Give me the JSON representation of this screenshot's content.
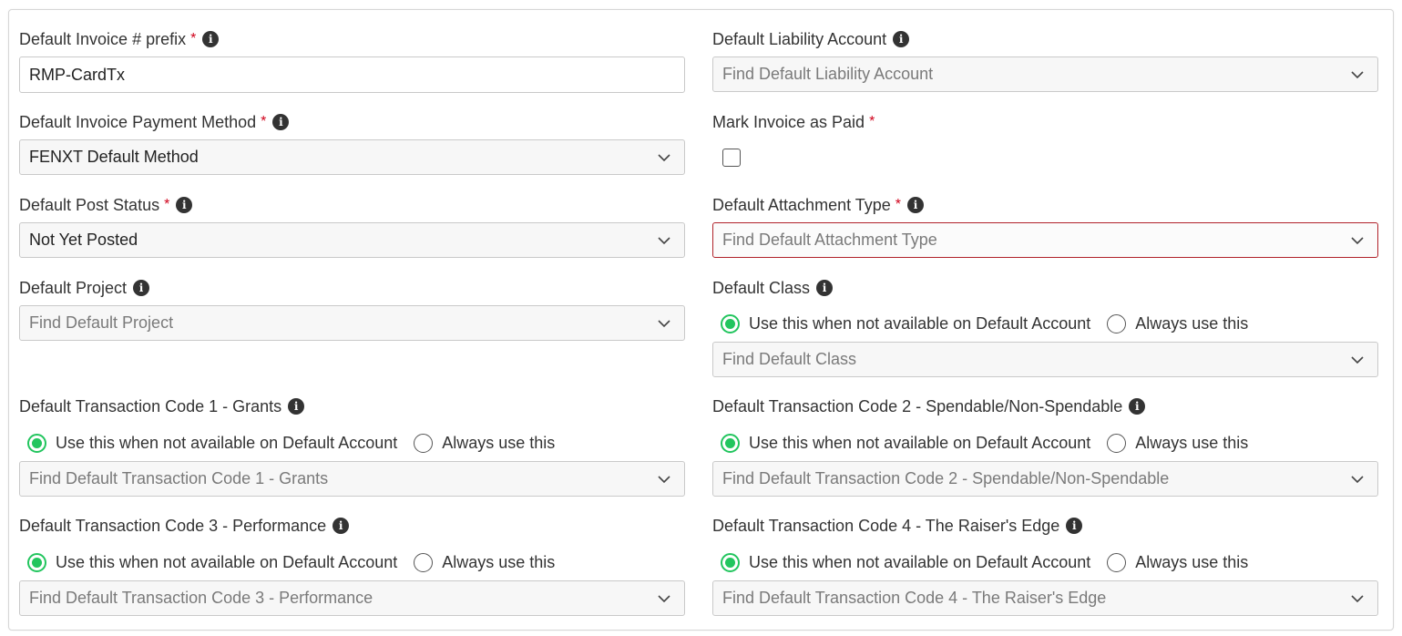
{
  "fields": {
    "invoice_prefix": {
      "label": "Default Invoice # prefix",
      "value": "RMP-CardTx"
    },
    "liability_account": {
      "label": "Default Liability Account",
      "placeholder": "Find Default Liability Account"
    },
    "payment_method": {
      "label": "Default Invoice Payment Method",
      "value": "FENXT Default Method"
    },
    "mark_paid": {
      "label": "Mark Invoice as Paid",
      "checked": false
    },
    "post_status": {
      "label": "Default Post Status",
      "value": "Not Yet Posted"
    },
    "attachment_type": {
      "label": "Default Attachment Type",
      "placeholder": "Find Default Attachment Type"
    },
    "project": {
      "label": "Default Project",
      "placeholder": "Find Default Project"
    },
    "class": {
      "label": "Default Class",
      "placeholder": "Find Default Class"
    },
    "tx_code_1": {
      "label": "Default Transaction Code 1 - Grants",
      "placeholder": "Find Default Transaction Code 1 - Grants"
    },
    "tx_code_2": {
      "label": "Default Transaction Code 2 - Spendable/Non-Spendable",
      "placeholder": "Find Default Transaction Code 2 - Spendable/Non-Spendable"
    },
    "tx_code_3": {
      "label": "Default Transaction Code 3 - Performance",
      "placeholder": "Find Default Transaction Code 3 - Performance"
    },
    "tx_code_4": {
      "label": "Default Transaction Code 4 - The Raiser's Edge",
      "placeholder": "Find Default Transaction Code 4 - The Raiser's Edge"
    }
  },
  "radio_options": {
    "when_unavailable": "Use this when not available on Default Account",
    "always": "Always use this"
  },
  "required_marker": "*",
  "info_glyph": "i",
  "colors": {
    "required": "#d0021b",
    "radio_selected": "#22c55e",
    "error_border": "#b0222a"
  }
}
